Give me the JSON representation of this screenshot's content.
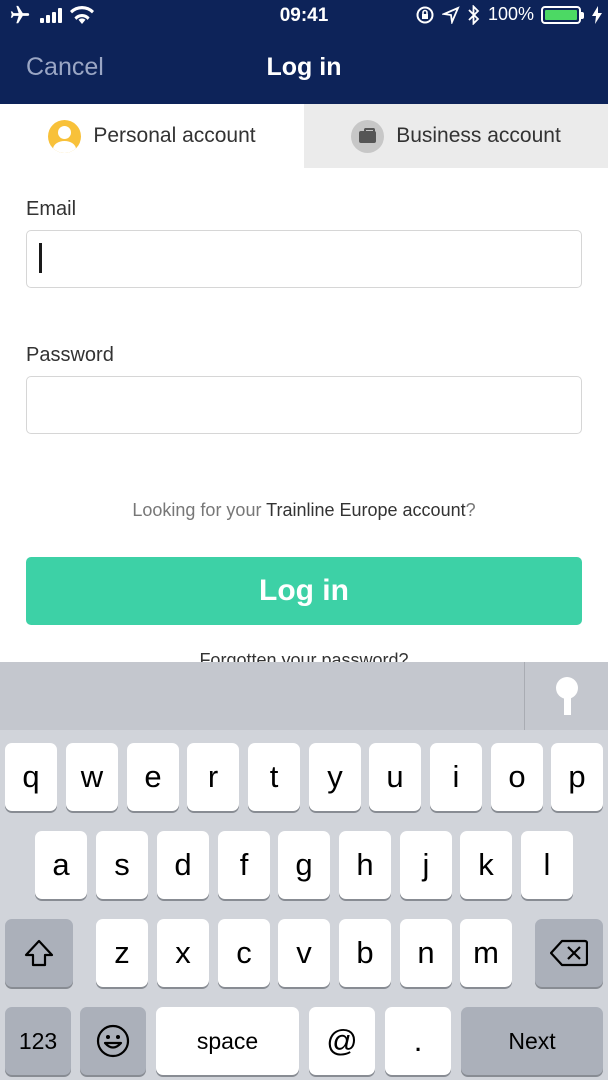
{
  "status_bar": {
    "time": "09:41",
    "battery_text": "100%",
    "icons": [
      "airplane-icon",
      "signal-icon",
      "wifi-icon",
      "rotation-lock-icon",
      "location-icon",
      "bluetooth-icon",
      "battery-icon",
      "charging-icon"
    ]
  },
  "nav": {
    "cancel_label": "Cancel",
    "title": "Log in"
  },
  "tabs": [
    {
      "label": "Personal account",
      "icon": "avatar-icon",
      "active": true
    },
    {
      "label": "Business account",
      "icon": "briefcase-icon",
      "active": false
    }
  ],
  "form": {
    "email_label": "Email",
    "email_value": "",
    "password_label": "Password",
    "password_value": "",
    "europe_prefix": "Looking for your ",
    "europe_link": "Trainline Europe account",
    "europe_suffix": "?",
    "login_label": "Log in",
    "forgot_label": "Forgotten your password?"
  },
  "keyboard": {
    "row1": [
      "q",
      "w",
      "e",
      "r",
      "t",
      "y",
      "u",
      "i",
      "o",
      "p"
    ],
    "row2": [
      "a",
      "s",
      "d",
      "f",
      "g",
      "h",
      "j",
      "k",
      "l"
    ],
    "row3": [
      "z",
      "x",
      "c",
      "v",
      "b",
      "n",
      "m"
    ],
    "numbers_label": "123",
    "space_label": "space",
    "at_label": "@",
    "dot_label": ".",
    "next_label": "Next"
  },
  "colors": {
    "nav_bg": "#0d2359",
    "login_button": "#3dd1a6",
    "battery_fill": "#4cd964",
    "personal_icon": "#f8c13a"
  }
}
